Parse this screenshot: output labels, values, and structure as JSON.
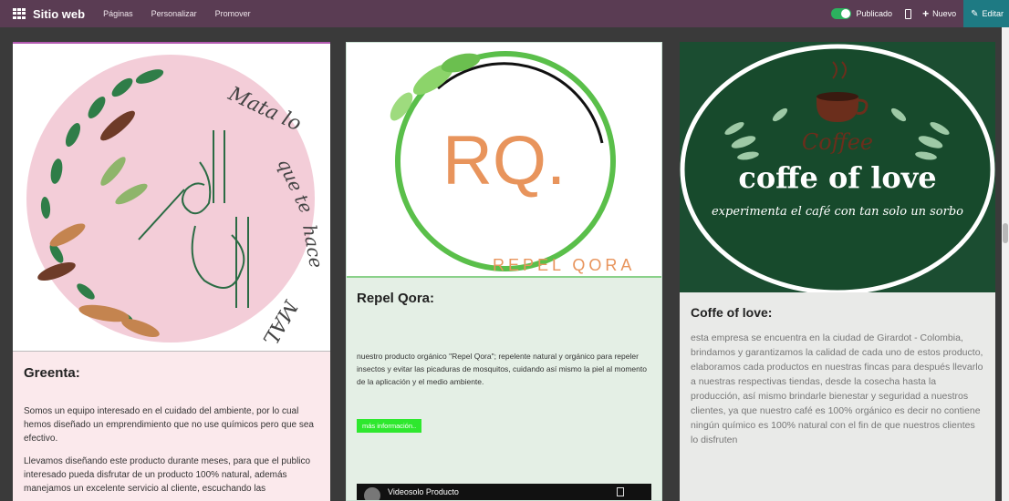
{
  "navbar": {
    "brand": "Sitio web",
    "menu": [
      "Páginas",
      "Personalizar",
      "Promover"
    ],
    "publish_label": "Publicado",
    "new_label": "Nuevo",
    "edit_label": "Editar",
    "colors": {
      "bar": "#5a3c53",
      "edit": "#1e7a83",
      "toggle": "#2cb15e"
    }
  },
  "cards": [
    {
      "logo_text": "Mata lo que te hace MAL",
      "title": "Greenta:",
      "paragraphs": [
        "Somos un equipo interesado en el cuidado del ambiente, por lo cual hemos diseñado un emprendimiento que no use químicos pero que sea efectivo.",
        "Llevamos diseñando este producto durante meses, para que el publico interesado pueda disfrutar de un producto 100% natural, además manejamos un excelente servicio al cliente, escuchando las"
      ]
    },
    {
      "logo_text": "RQ.",
      "logo_subtext": "REPEL QORA",
      "title": "Repel Qora:",
      "paragraph": "nuestro producto orgánico \"Repel Qora\"; repelente natural y orgánico para repeler insectos y evitar las picaduras de mosquitos, cuidando así mismo la piel al momento de la aplicación y el medio ambiente.",
      "button_label": "más información..",
      "video_title": "Videosolo Producto"
    },
    {
      "logo_small": "Coffee",
      "logo_main": "coffe of love",
      "logo_tagline": "experimenta el café con tan solo un sorbo",
      "title": "Coffe of love:",
      "paragraph": "esta empresa se encuentra en la ciudad de Girardot - Colombia, brindamos y garantizamos la calidad de cada uno de estos producto, elaboramos cada  productos en nuestras fincas para después llevarlo a nuestras respectivas tiendas, desde la cosecha hasta la producción, así mismo brindarle bienestar y seguridad a nuestros clientes, ya que  nuestro café es 100% orgánico es decir no contiene ningún químico es 100% natural con el fin de que nuestros clientes lo disfruten"
    }
  ]
}
